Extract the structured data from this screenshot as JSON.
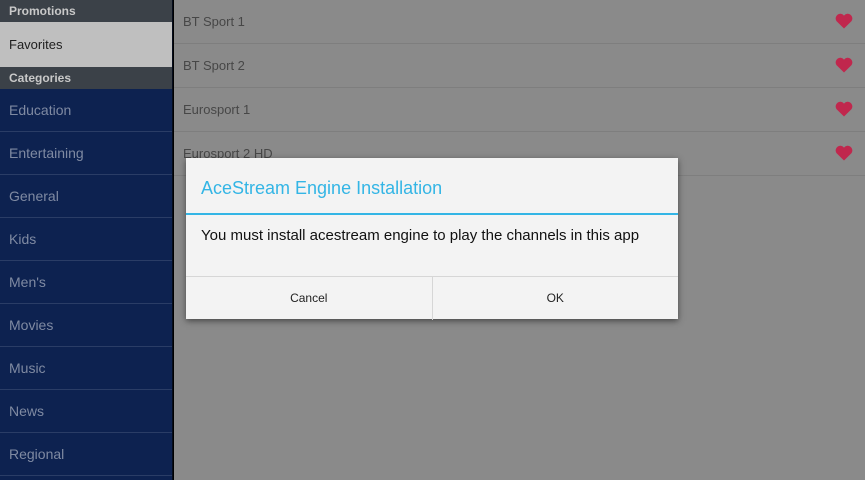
{
  "sidebar": {
    "promotions_header": "Promotions",
    "favorites_label": "Favorites",
    "categories_header": "Categories",
    "categories": [
      "Education",
      "Entertaining",
      "General",
      "Kids",
      "Men's",
      "Movies",
      "Music",
      "News",
      "Regional"
    ]
  },
  "channels": [
    {
      "name": "BT Sport 1",
      "favorite_icon": "heart-icon"
    },
    {
      "name": "BT Sport 2",
      "favorite_icon": "heart-icon"
    },
    {
      "name": "Eurosport 1",
      "favorite_icon": "heart-icon"
    },
    {
      "name": "Eurosport 2 HD",
      "favorite_icon": "heart-icon"
    }
  ],
  "dialog": {
    "title": "AceStream Engine Installation",
    "message": "You must install acestream engine to play the channels in this app",
    "cancel_label": "Cancel",
    "ok_label": "OK"
  },
  "colors": {
    "accent": "#33b5e5",
    "heart": "#c0274d",
    "sidebar_bg": "#0d2250"
  }
}
